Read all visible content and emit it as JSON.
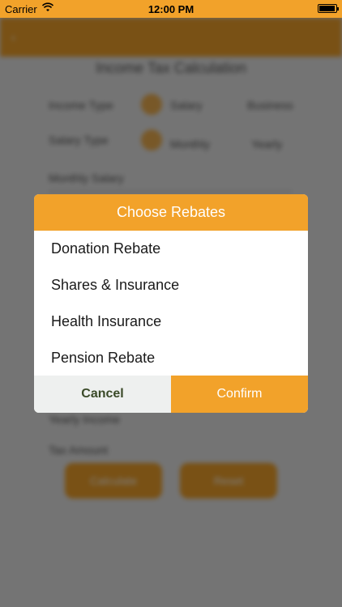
{
  "status_bar": {
    "carrier": "Carrier",
    "time": "12:00 PM",
    "wifi_icon": "wifi-icon",
    "battery_icon": "battery-icon"
  },
  "background": {
    "title": "Income Tax Calculation",
    "income_type_label": "Income Type",
    "salary_option": "Salary",
    "business_option": "Business",
    "salary_type_label": "Salary Type",
    "monthly_option": "Monthly",
    "yearly_option": "Yearly",
    "monthly_salary_label": "Monthly Salary",
    "yearly_income_label": "Yearly Income",
    "tax_amount_label": "Tax Amount",
    "calculate_button": "Calculate",
    "reset_button": "Reset"
  },
  "dialog": {
    "title": "Choose Rebates",
    "options": [
      "Donation Rebate",
      "Shares & Insurance",
      "Health Insurance",
      "Pension Rebate"
    ],
    "cancel_label": "Cancel",
    "confirm_label": "Confirm"
  },
  "colors": {
    "accent": "#f2a22a",
    "cancel_bg": "#eef0ef",
    "cancel_text": "#3a4a28"
  }
}
